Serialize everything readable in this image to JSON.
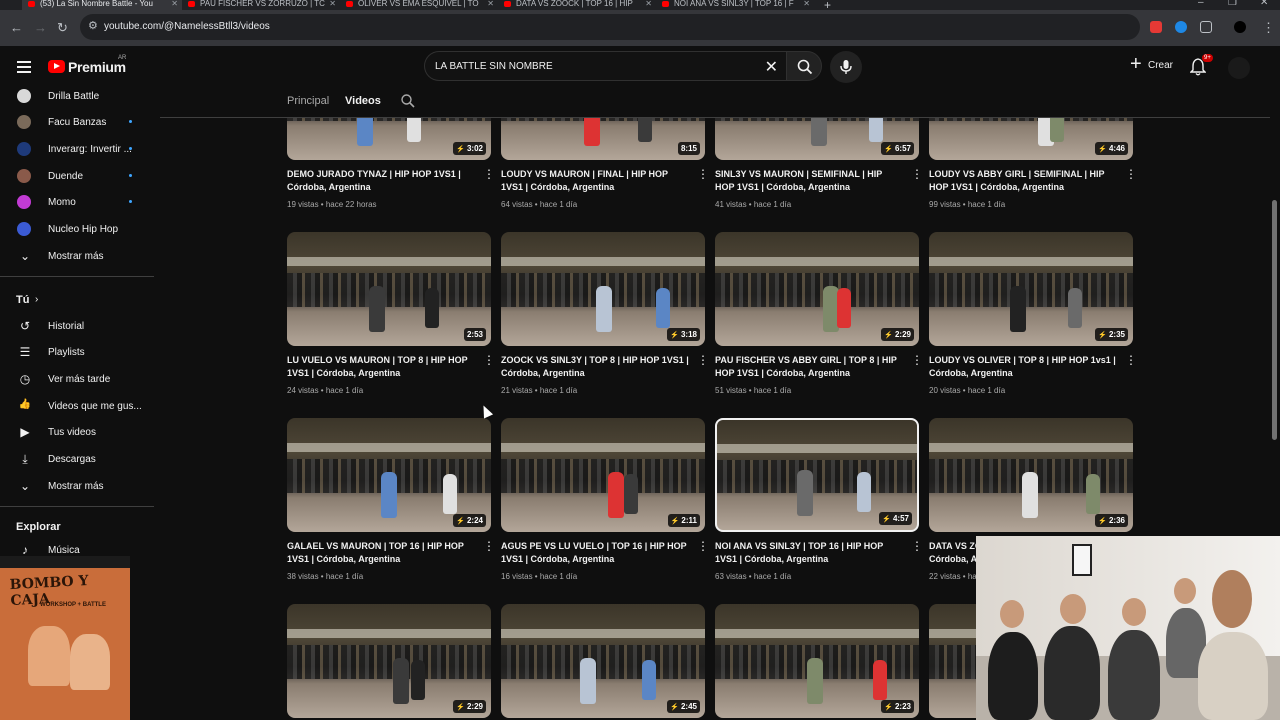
{
  "browser": {
    "tabs": [
      {
        "label": "(53) La Sin Nombre Battle - You",
        "active": true
      },
      {
        "label": "PAU FISCHER VS ZORRUZO | TC",
        "active": false
      },
      {
        "label": "OLIVER VS EMA ESQUIVEL | TO",
        "active": false
      },
      {
        "label": "DATA VS ZOOCK | TOP 16 | HIP",
        "active": false
      },
      {
        "label": "NOI ANA VS SINL3Y | TOP 16 | F",
        "active": false
      }
    ],
    "url": "youtube.com/@NamelessBtll3/videos"
  },
  "header": {
    "logo_text": "Premium",
    "country_code": "AR",
    "search_query": "LA BATTLE SIN NOMBRE",
    "create_label": "Crear",
    "notifications_badge": "9+"
  },
  "sidebar": {
    "subscriptions": [
      {
        "label": "Drilla Battle",
        "color": "#d8d8d8",
        "dot": false
      },
      {
        "label": "Facu Banzas",
        "color": "#7a6a5a",
        "dot": true
      },
      {
        "label": "Inverarg: Invertir ...",
        "color": "#1e3a7a",
        "dot": true
      },
      {
        "label": "Duende",
        "color": "#8a5a4a",
        "dot": true
      },
      {
        "label": "Momo",
        "color": "#c23bd4",
        "dot": true
      },
      {
        "label": "Nucleo Hip Hop",
        "color": "#3b5bd4",
        "dot": false
      }
    ],
    "show_more_1": "Mostrar más",
    "you_title": "Tú",
    "you_items": [
      {
        "label": "Historial",
        "icon": "history-icon",
        "glyph": "↺"
      },
      {
        "label": "Playlists",
        "icon": "playlists-icon",
        "glyph": "☰"
      },
      {
        "label": "Ver más tarde",
        "icon": "watch-later-icon",
        "glyph": "◷"
      },
      {
        "label": "Videos que me gus...",
        "icon": "liked-videos-icon",
        "glyph": "👍"
      },
      {
        "label": "Tus videos",
        "icon": "your-videos-icon",
        "glyph": "▶"
      },
      {
        "label": "Descargas",
        "icon": "downloads-icon",
        "glyph": "⤓"
      }
    ],
    "show_more_2": "Mostrar más",
    "explore_title": "Explorar",
    "explore_items": [
      {
        "label": "Música",
        "icon": "music-icon",
        "glyph": "♪"
      }
    ],
    "promo": {
      "line1": "BOMBO Y CAJA",
      "line2": "WORKSHOP + BATTLE"
    }
  },
  "channel_tabs": {
    "home": "Principal",
    "videos": "Videos"
  },
  "videos": [
    {
      "title": "DEMO JURADO TYNAZ | HIP HOP 1VS1 | Córdoba, Argentina",
      "meta": "19 vistas • hace 22 horas",
      "duration": "3:02",
      "short": true
    },
    {
      "title": "LOUDY VS MAURON | FINAL | HIP HOP 1VS1 | Córdoba, Argentina",
      "meta": "64 vistas • hace 1 día",
      "duration": "8:15",
      "short": false
    },
    {
      "title": "SINL3Y VS MAURON | SEMIFINAL | HIP HOP 1VS1 | Córdoba, Argentina",
      "meta": "41 vistas • hace 1 día",
      "duration": "6:57",
      "short": true
    },
    {
      "title": "LOUDY VS ABBY GIRL | SEMIFINAL | HIP HOP 1VS1 | Córdoba, Argentina",
      "meta": "99 vistas • hace 1 día",
      "duration": "4:46",
      "short": true
    },
    {
      "title": "LU VUELO VS MAURON | TOP 8 | HIP HOP 1VS1 | Córdoba, Argentina",
      "meta": "24 vistas • hace 1 día",
      "duration": "2:53",
      "short": false
    },
    {
      "title": "ZOOCK VS SINL3Y | TOP 8 | HIP HOP 1VS1 | Córdoba, Argentina",
      "meta": "21 vistas • hace 1 día",
      "duration": "3:18",
      "short": true
    },
    {
      "title": "PAU FISCHER VS ABBY GIRL | TOP 8 | HIP HOP 1VS1 | Córdoba, Argentina",
      "meta": "51 vistas • hace 1 día",
      "duration": "2:29",
      "short": true
    },
    {
      "title": "LOUDY VS OLIVER | TOP 8 | HIP HOP 1vs1 | Córdoba, Argentina",
      "meta": "20 vistas • hace 1 día",
      "duration": "2:35",
      "short": true
    },
    {
      "title": "GALAEL VS MAURON | TOP 16 | HIP HOP 1VS1 | Córdoba, Argentina",
      "meta": "38 vistas • hace 1 día",
      "duration": "2:24",
      "short": true
    },
    {
      "title": "AGUS PE VS LU VUELO | TOP 16 | HIP HOP 1VS1 | Córdoba, Argentina",
      "meta": "16 vistas • hace 1 día",
      "duration": "2:11",
      "short": true
    },
    {
      "title": "NOI ANA VS SINL3Y | TOP 16 | HIP HOP 1VS1 | Córdoba, Argentina",
      "meta": "63 vistas • hace 1 día",
      "duration": "4:57",
      "short": true
    },
    {
      "title": "DATA VS ZOOCK | TOP 16 | HIP HOP 1VS1 | Córdoba, Argentina",
      "meta": "22 vistas • hace 1 día",
      "duration": "2:36",
      "short": true
    },
    {
      "title": "",
      "meta": "",
      "duration": "2:29",
      "short": true
    },
    {
      "title": "",
      "meta": "",
      "duration": "2:45",
      "short": true
    },
    {
      "title": "",
      "meta": "",
      "duration": "2:23",
      "short": true
    },
    {
      "title": "",
      "meta": "",
      "duration": "",
      "short": false
    }
  ],
  "colors": {
    "accent_red": "#ff0000",
    "link_blue": "#3ea6ff",
    "background": "#0f0f0f"
  }
}
